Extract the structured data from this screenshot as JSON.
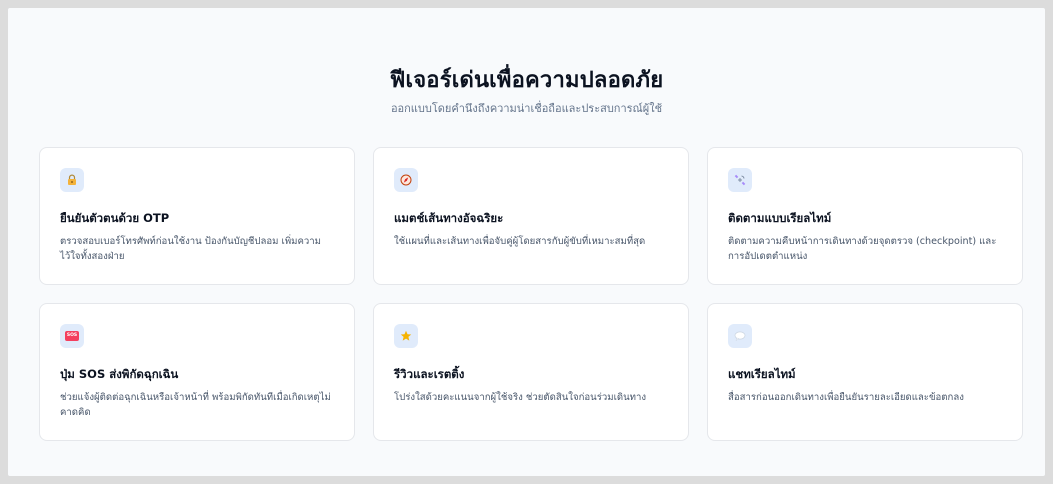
{
  "section": {
    "title": "ฟีเจอร์เด่นเพื่อความปลอดภัย",
    "subtitle": "ออกแบบโดยคำนึงถึงความน่าเชื่อถือและประสบการณ์ผู้ใช้"
  },
  "features": [
    {
      "icon": "lock-icon",
      "title": "ยืนยันตัวตนด้วย OTP",
      "description": "ตรวจสอบเบอร์โทรศัพท์ก่อนใช้งาน ป้องกันบัญชีปลอม เพิ่มความไว้ใจทั้งสองฝ่าย"
    },
    {
      "icon": "compass-icon",
      "title": "แมตช์เส้นทางอัจฉริยะ",
      "description": "ใช้แผนที่และเส้นทางเพื่อจับคู่ผู้โดยสารกับผู้ขับที่เหมาะสมที่สุด"
    },
    {
      "icon": "satellite-icon",
      "title": "ติดตามแบบเรียลไทม์",
      "description": "ติดตามความคืบหน้าการเดินทางด้วยจุดตรวจ (checkpoint) และการอัปเดตตำแหน่ง"
    },
    {
      "icon": "sos-icon",
      "icon_text": "SOS",
      "title": "ปุ่ม SOS ส่งพิกัดฉุกเฉิน",
      "description": "ช่วยแจ้งผู้ติดต่อฉุกเฉินหรือเจ้าหน้าที่ พร้อมพิกัดทันทีเมื่อเกิดเหตุไม่คาดคิด"
    },
    {
      "icon": "star-icon",
      "title": "รีวิวและเรตติ้ง",
      "description": "โปร่งใสด้วยคะแนนจากผู้ใช้จริง ช่วยตัดสินใจก่อนร่วมเดินทาง"
    },
    {
      "icon": "chat-bubble-icon",
      "title": "แชทเรียลไทม์",
      "description": "สื่อสารก่อนออกเดินทางเพื่อยืนยันรายละเอียดและข้อตกลง"
    }
  ],
  "colors": {
    "page_background": "#f8fafc",
    "card_background": "#ffffff",
    "icon_tile": "#e0ebfb",
    "title_text": "#0b1220",
    "body_text": "#475569"
  }
}
